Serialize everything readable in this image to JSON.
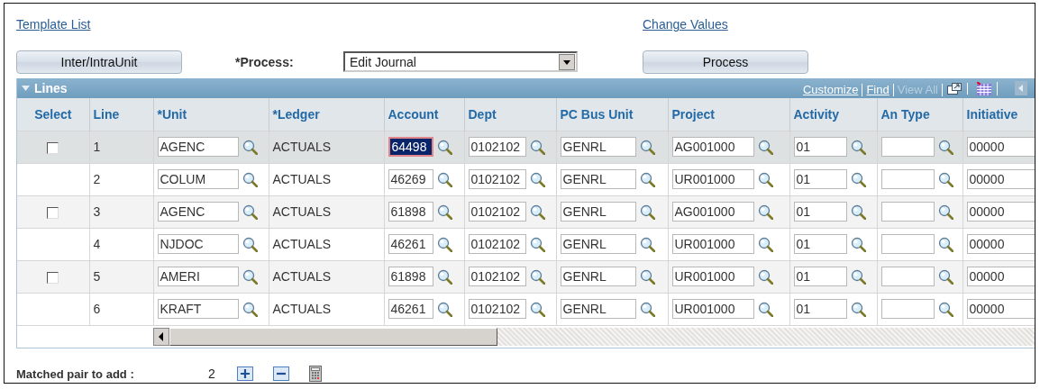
{
  "links": [
    {
      "label": "Template List"
    },
    {
      "label": "Change Values"
    }
  ],
  "toolbar": {
    "left_button": "Inter/IntraUnit",
    "process_label": "*Process:",
    "process_value": "Edit Journal",
    "process_button": "Process"
  },
  "grid": {
    "title": "Lines",
    "expanded": true,
    "header_links": [
      {
        "label": "Customize",
        "disabled": false
      },
      {
        "label": "Find",
        "disabled": false
      },
      {
        "label": "View All",
        "disabled": true
      }
    ],
    "columns": [
      "Select",
      "Line",
      "*Unit",
      "*Ledger",
      "Account",
      "Dept",
      "PC Bus Unit",
      "Project",
      "Activity",
      "An Type",
      "Initiative"
    ],
    "rows": [
      {
        "selected": true,
        "cells": [
          {
            "kind": "checkbox",
            "checked": false
          },
          {
            "kind": "text",
            "text": "1"
          },
          {
            "kind": "lookup",
            "value": "AGENC",
            "highlighted": false
          },
          {
            "kind": "text",
            "text": "ACTUALS"
          },
          {
            "kind": "lookup",
            "value": "64498",
            "highlighted": true
          },
          {
            "kind": "lookup",
            "value": "0102102",
            "highlighted": false
          },
          {
            "kind": "lookup",
            "value": "GENRL",
            "highlighted": false
          },
          {
            "kind": "lookup",
            "value": "AG001000",
            "highlighted": false
          },
          {
            "kind": "lookup",
            "value": "01",
            "highlighted": false
          },
          {
            "kind": "lookup",
            "highlighted": false
          },
          {
            "kind": "field",
            "value": "00000",
            "highlighted": false
          }
        ]
      },
      {
        "selected": false,
        "cells": [
          {
            "kind": "empty"
          },
          {
            "kind": "text",
            "text": "2"
          },
          {
            "kind": "lookup",
            "value": "COLUM",
            "highlighted": false
          },
          {
            "kind": "text",
            "text": "ACTUALS"
          },
          {
            "kind": "lookup",
            "value": "46269",
            "highlighted": false
          },
          {
            "kind": "lookup",
            "value": "0102102",
            "highlighted": false
          },
          {
            "kind": "lookup",
            "value": "GENRL",
            "highlighted": false
          },
          {
            "kind": "lookup",
            "value": "UR001000",
            "highlighted": false
          },
          {
            "kind": "lookup",
            "value": "01",
            "highlighted": false
          },
          {
            "kind": "lookup",
            "highlighted": false
          },
          {
            "kind": "field",
            "value": "00000",
            "highlighted": false
          }
        ]
      },
      {
        "selected": false,
        "cells": [
          {
            "kind": "checkbox",
            "checked": false
          },
          {
            "kind": "text",
            "text": "3"
          },
          {
            "kind": "lookup",
            "value": "AGENC",
            "highlighted": false
          },
          {
            "kind": "text",
            "text": "ACTUALS"
          },
          {
            "kind": "lookup",
            "value": "61898",
            "highlighted": false
          },
          {
            "kind": "lookup",
            "value": "0102102",
            "highlighted": false
          },
          {
            "kind": "lookup",
            "value": "GENRL",
            "highlighted": false
          },
          {
            "kind": "lookup",
            "value": "AG001000",
            "highlighted": false
          },
          {
            "kind": "lookup",
            "value": "01",
            "highlighted": false
          },
          {
            "kind": "lookup",
            "highlighted": false
          },
          {
            "kind": "field",
            "value": "00000",
            "highlighted": false
          }
        ]
      },
      {
        "selected": false,
        "cells": [
          {
            "kind": "empty"
          },
          {
            "kind": "text",
            "text": "4"
          },
          {
            "kind": "lookup",
            "value": "NJDOC",
            "highlighted": false
          },
          {
            "kind": "text",
            "text": "ACTUALS"
          },
          {
            "kind": "lookup",
            "value": "46261",
            "highlighted": false
          },
          {
            "kind": "lookup",
            "value": "0102102",
            "highlighted": false
          },
          {
            "kind": "lookup",
            "value": "GENRL",
            "highlighted": false
          },
          {
            "kind": "lookup",
            "value": "UR001000",
            "highlighted": false
          },
          {
            "kind": "lookup",
            "value": "01",
            "highlighted": false
          },
          {
            "kind": "lookup",
            "highlighted": false
          },
          {
            "kind": "field",
            "value": "00000",
            "highlighted": false
          }
        ]
      },
      {
        "selected": false,
        "cells": [
          {
            "kind": "checkbox",
            "checked": false
          },
          {
            "kind": "text",
            "text": "5"
          },
          {
            "kind": "lookup",
            "value": "AMERI",
            "highlighted": false
          },
          {
            "kind": "text",
            "text": "ACTUALS"
          },
          {
            "kind": "lookup",
            "value": "61898",
            "highlighted": false
          },
          {
            "kind": "lookup",
            "value": "0102102",
            "highlighted": false
          },
          {
            "kind": "lookup",
            "value": "GENRL",
            "highlighted": false
          },
          {
            "kind": "lookup",
            "value": "UR001000",
            "highlighted": false
          },
          {
            "kind": "lookup",
            "value": "01",
            "highlighted": false
          },
          {
            "kind": "lookup",
            "highlighted": false
          },
          {
            "kind": "field",
            "value": "00000",
            "highlighted": false
          }
        ]
      },
      {
        "selected": false,
        "cells": [
          {
            "kind": "empty"
          },
          {
            "kind": "text",
            "text": "6"
          },
          {
            "kind": "lookup",
            "value": "KRAFT",
            "highlighted": false
          },
          {
            "kind": "text",
            "text": "ACTUALS"
          },
          {
            "kind": "lookup",
            "value": "46261",
            "highlighted": false
          },
          {
            "kind": "lookup",
            "value": "0102102",
            "highlighted": false
          },
          {
            "kind": "lookup",
            "value": "GENRL",
            "highlighted": false
          },
          {
            "kind": "lookup",
            "value": "UR001000",
            "highlighted": false
          },
          {
            "kind": "lookup",
            "value": "01",
            "highlighted": false
          },
          {
            "kind": "lookup",
            "highlighted": false
          },
          {
            "kind": "field",
            "value": "00000",
            "highlighted": false
          }
        ]
      }
    ]
  },
  "footer": {
    "label": "Matched pair to add :",
    "count": "2"
  }
}
